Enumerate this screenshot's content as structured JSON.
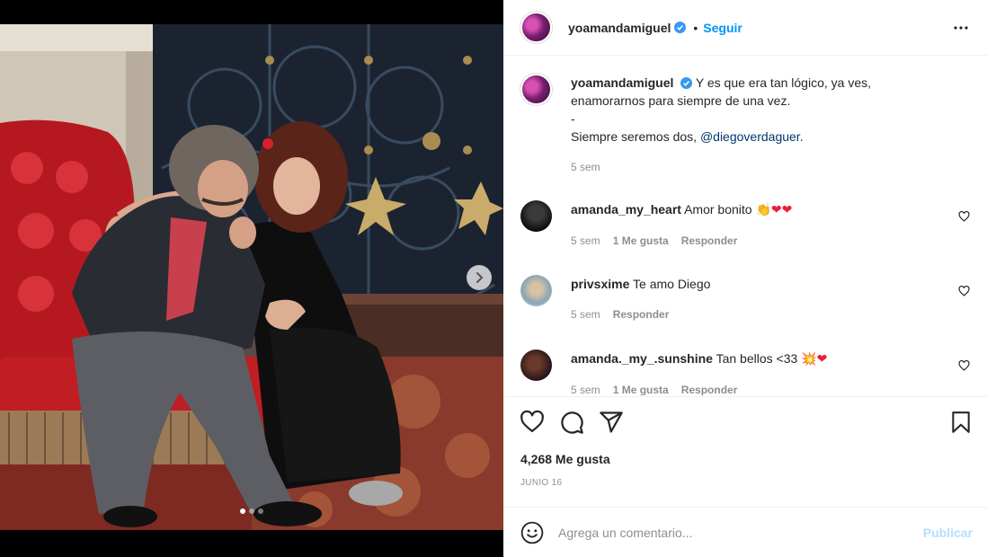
{
  "media": {
    "slide_count": 3,
    "active_slide": 1,
    "next_icon": "chevron-right-icon"
  },
  "header": {
    "username": "yoamandamiguel",
    "separator": "•",
    "follow_label": "Seguir",
    "more_icon": "more-horizontal-icon"
  },
  "caption": {
    "username": "yoamandamiguel",
    "line1": "Y es que era tan lógico, ya ves,",
    "line2": "enamorarnos para siempre de una vez.",
    "line3": "-",
    "line4_prefix": "Siempre seremos dos, ",
    "mention": "@diegoverdaguer",
    "line4_suffix": ".",
    "time": "5 sem"
  },
  "comments": [
    {
      "username": "amanda_my_heart",
      "text": "Amor bonito",
      "emojis": [
        "👏",
        "❤",
        "❤"
      ],
      "time": "5 sem",
      "likes": "1 Me gusta",
      "reply": "Responder"
    },
    {
      "username": "privsxime",
      "text": "Te amo Diego",
      "time": "5 sem",
      "reply": "Responder"
    },
    {
      "username": "amanda._my_.sunshine",
      "text": "Tan bellos <33",
      "emojis": [
        "💥",
        "❤"
      ],
      "time": "5 sem",
      "likes": "1 Me gusta",
      "reply": "Responder"
    }
  ],
  "actions": {
    "like_icon": "heart-icon",
    "comment_icon": "comment-icon",
    "share_icon": "paper-plane-icon",
    "save_icon": "bookmark-icon"
  },
  "likes_count": "4,268 Me gusta",
  "date": "JUNIO 16",
  "add_comment": {
    "emoji_icon": "smiley-icon",
    "placeholder": "Agrega un comentario...",
    "publish_label": "Publicar"
  },
  "colors": {
    "accent": "#0095f6",
    "publish_disabled": "#b2dffc",
    "verified": "#3897f0",
    "like_red": "#ed4956"
  }
}
